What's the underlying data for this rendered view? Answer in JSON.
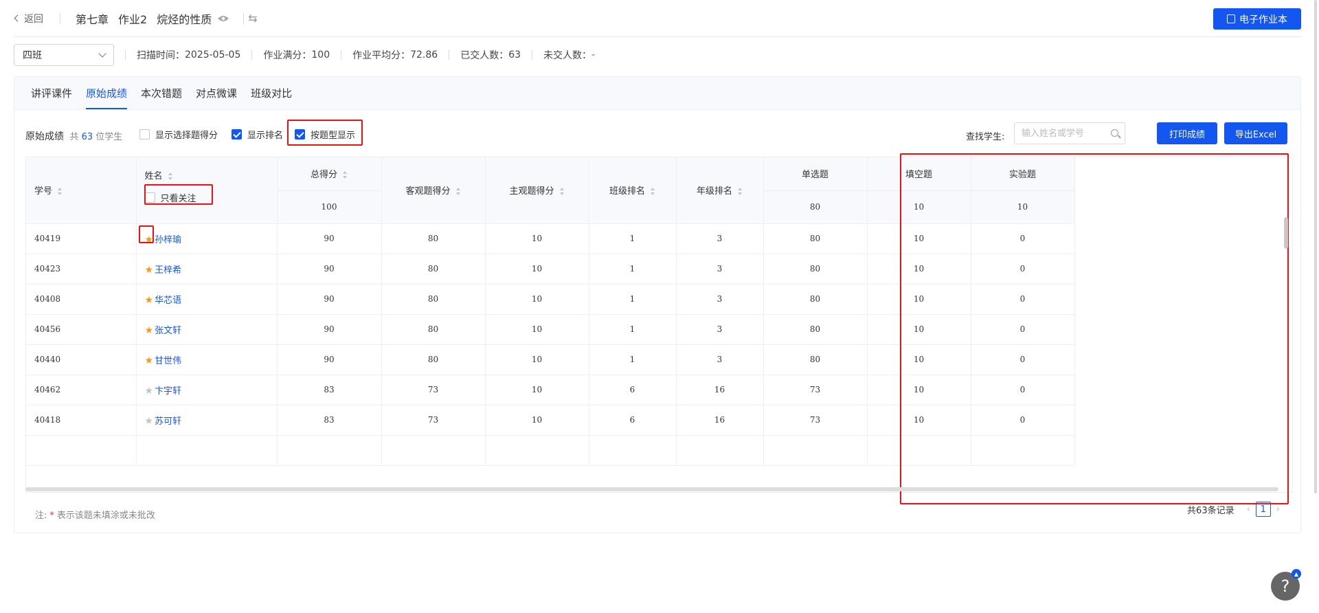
{
  "header": {
    "back_label": "返回",
    "chapter": "第七章",
    "assignment": "作业2",
    "topic": "烷烃的性质",
    "ebook_label": "电子作业本"
  },
  "info": {
    "class_select": "四班",
    "scan_time_label": "扫描时间：",
    "scan_time": "2025-05-05",
    "full_score_label": "作业满分：",
    "full_score": "100",
    "avg_label": "作业平均分：",
    "avg": "72.86",
    "submitted_label": "已交人数：",
    "submitted": "63",
    "unsubmitted_label": "未交人数：",
    "unsubmitted": "-"
  },
  "tabs": [
    "讲评课件",
    "原始成绩",
    "本次错题",
    "对点微课",
    "班级对比"
  ],
  "toolbar": {
    "title": "原始成绩",
    "count_prefix": "共",
    "count": "63",
    "count_suffix": "位学生",
    "opt_choice_score": "显示选择题得分",
    "opt_rank": "显示排名",
    "opt_by_type": "按题型显示",
    "find_label": "查找学生:",
    "search_placeholder": "输入姓名或学号",
    "print_label": "打印成绩",
    "export_label": "导出Excel"
  },
  "table": {
    "col_id": "学号",
    "col_name": "姓名",
    "only_follow": "只看关注",
    "col_total": "总得分",
    "total_full": "100",
    "col_objective": "客观题得分",
    "col_subjective": "主观题得分",
    "col_class_rank": "班级排名",
    "col_grade_rank": "年级排名",
    "col_single": "单选题",
    "single_full": "80",
    "col_fill": "填空题",
    "fill_full": "10",
    "col_lab": "实验题",
    "lab_full": "10",
    "rows": [
      {
        "id": "40419",
        "name": "孙梓瑜",
        "star": true,
        "total": "90",
        "obj": "80",
        "subj": "10",
        "crank": "1",
        "grank": "3",
        "single": "80",
        "fill": "10",
        "lab": "0"
      },
      {
        "id": "40423",
        "name": "王梓希",
        "star": true,
        "total": "90",
        "obj": "80",
        "subj": "10",
        "crank": "1",
        "grank": "3",
        "single": "80",
        "fill": "10",
        "lab": "0"
      },
      {
        "id": "40408",
        "name": "华芯语",
        "star": true,
        "total": "90",
        "obj": "80",
        "subj": "10",
        "crank": "1",
        "grank": "3",
        "single": "80",
        "fill": "10",
        "lab": "0"
      },
      {
        "id": "40456",
        "name": "张文轩",
        "star": true,
        "total": "90",
        "obj": "80",
        "subj": "10",
        "crank": "1",
        "grank": "3",
        "single": "80",
        "fill": "10",
        "lab": "0"
      },
      {
        "id": "40440",
        "name": "甘世伟",
        "star": true,
        "total": "90",
        "obj": "80",
        "subj": "10",
        "crank": "1",
        "grank": "3",
        "single": "80",
        "fill": "10",
        "lab": "0"
      },
      {
        "id": "40462",
        "name": "卞宇轩",
        "star": false,
        "total": "83",
        "obj": "73",
        "subj": "10",
        "crank": "6",
        "grank": "16",
        "single": "73",
        "fill": "10",
        "lab": "0"
      },
      {
        "id": "40418",
        "name": "苏可轩",
        "star": false,
        "total": "83",
        "obj": "73",
        "subj": "10",
        "crank": "6",
        "grank": "16",
        "single": "73",
        "fill": "10",
        "lab": "0"
      }
    ]
  },
  "footer": {
    "note_prefix": "注:",
    "note_asterisk": "*",
    "note_text": "表示该题未填涂或未批改",
    "total_records": "共63条记录",
    "page": "1"
  },
  "help_label": "?",
  "colors": {
    "accent": "#1456f0",
    "highlight": "#ee1111",
    "star": "#f39c12"
  }
}
